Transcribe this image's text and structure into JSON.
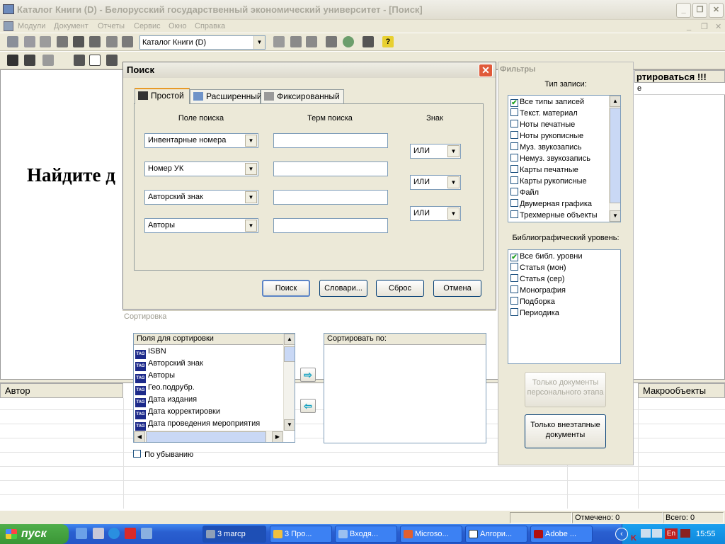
{
  "window": {
    "title": "Каталог Книги (D) - Белорусский государственный экономический университет - [Поиск]"
  },
  "menu": [
    "Модули",
    "Документ",
    "Отчеты",
    "Сервис",
    "Окно",
    "Справка"
  ],
  "toolbar": {
    "catalog_combo": "Каталог Книги (D)"
  },
  "background": {
    "big_text": "Найдите д",
    "right_header": "ртироваться !!!",
    "right_sub": "е",
    "col_author": "Автор",
    "col_macro": "Макрообъекты"
  },
  "status": {
    "marked": "Отмечено: 0",
    "total": "Всего: 0"
  },
  "dialog": {
    "title": "Поиск",
    "tabs": [
      "Простой",
      "Расширенный",
      "Фиксированный"
    ],
    "col_field": "Поле поиска",
    "col_term": "Терм поиска",
    "col_sign": "Знак",
    "fields": [
      "Инвентарные номера",
      "Номер УК",
      "Авторский знак",
      "Авторы"
    ],
    "signs": [
      "ИЛИ",
      "ИЛИ",
      "ИЛИ"
    ],
    "buttons": {
      "search": "Поиск",
      "dict": "Словари...",
      "reset": "Сброс",
      "cancel": "Отмена"
    }
  },
  "sort": {
    "title": "Сортировка",
    "fields_header": "Поля для сортировки",
    "fields": [
      "ISBN",
      "Авторский знак",
      "Авторы",
      "Гео.подрубр.",
      "Дата издания",
      "Дата корректировки",
      "Дата проведения мероприятия"
    ],
    "sortby_header": "Сортировать по:",
    "descending": "По убыванию"
  },
  "filters": {
    "title": "Фильтры",
    "record_type_label": "Тип записи:",
    "record_types": [
      "Все типы записей",
      "Текст. материал",
      "Ноты печатные",
      "Ноты рукописные",
      "Муз. звукозапись",
      "Немуз. звукозапись",
      "Карты печатные",
      "Карты рукописные",
      "Файл",
      "Двумерная графика",
      "Трехмерные объекты"
    ],
    "biblio_label": "Библиографический уровень:",
    "biblio_levels": [
      "Все библ. уровни",
      "Статья (мон)",
      "Статья (сер)",
      "Монография",
      "Подборка",
      "Периодика"
    ],
    "btn_personal": "Только документы персонального этапа",
    "btn_external": "Только внеэтапные документы"
  },
  "taskbar": {
    "start": "пуск",
    "tasks": [
      "3 marcp",
      "3 Про...",
      "Входя...",
      "Microso...",
      "Алгори...",
      "Adobe ..."
    ],
    "lang": "En",
    "clock": "15:55"
  }
}
